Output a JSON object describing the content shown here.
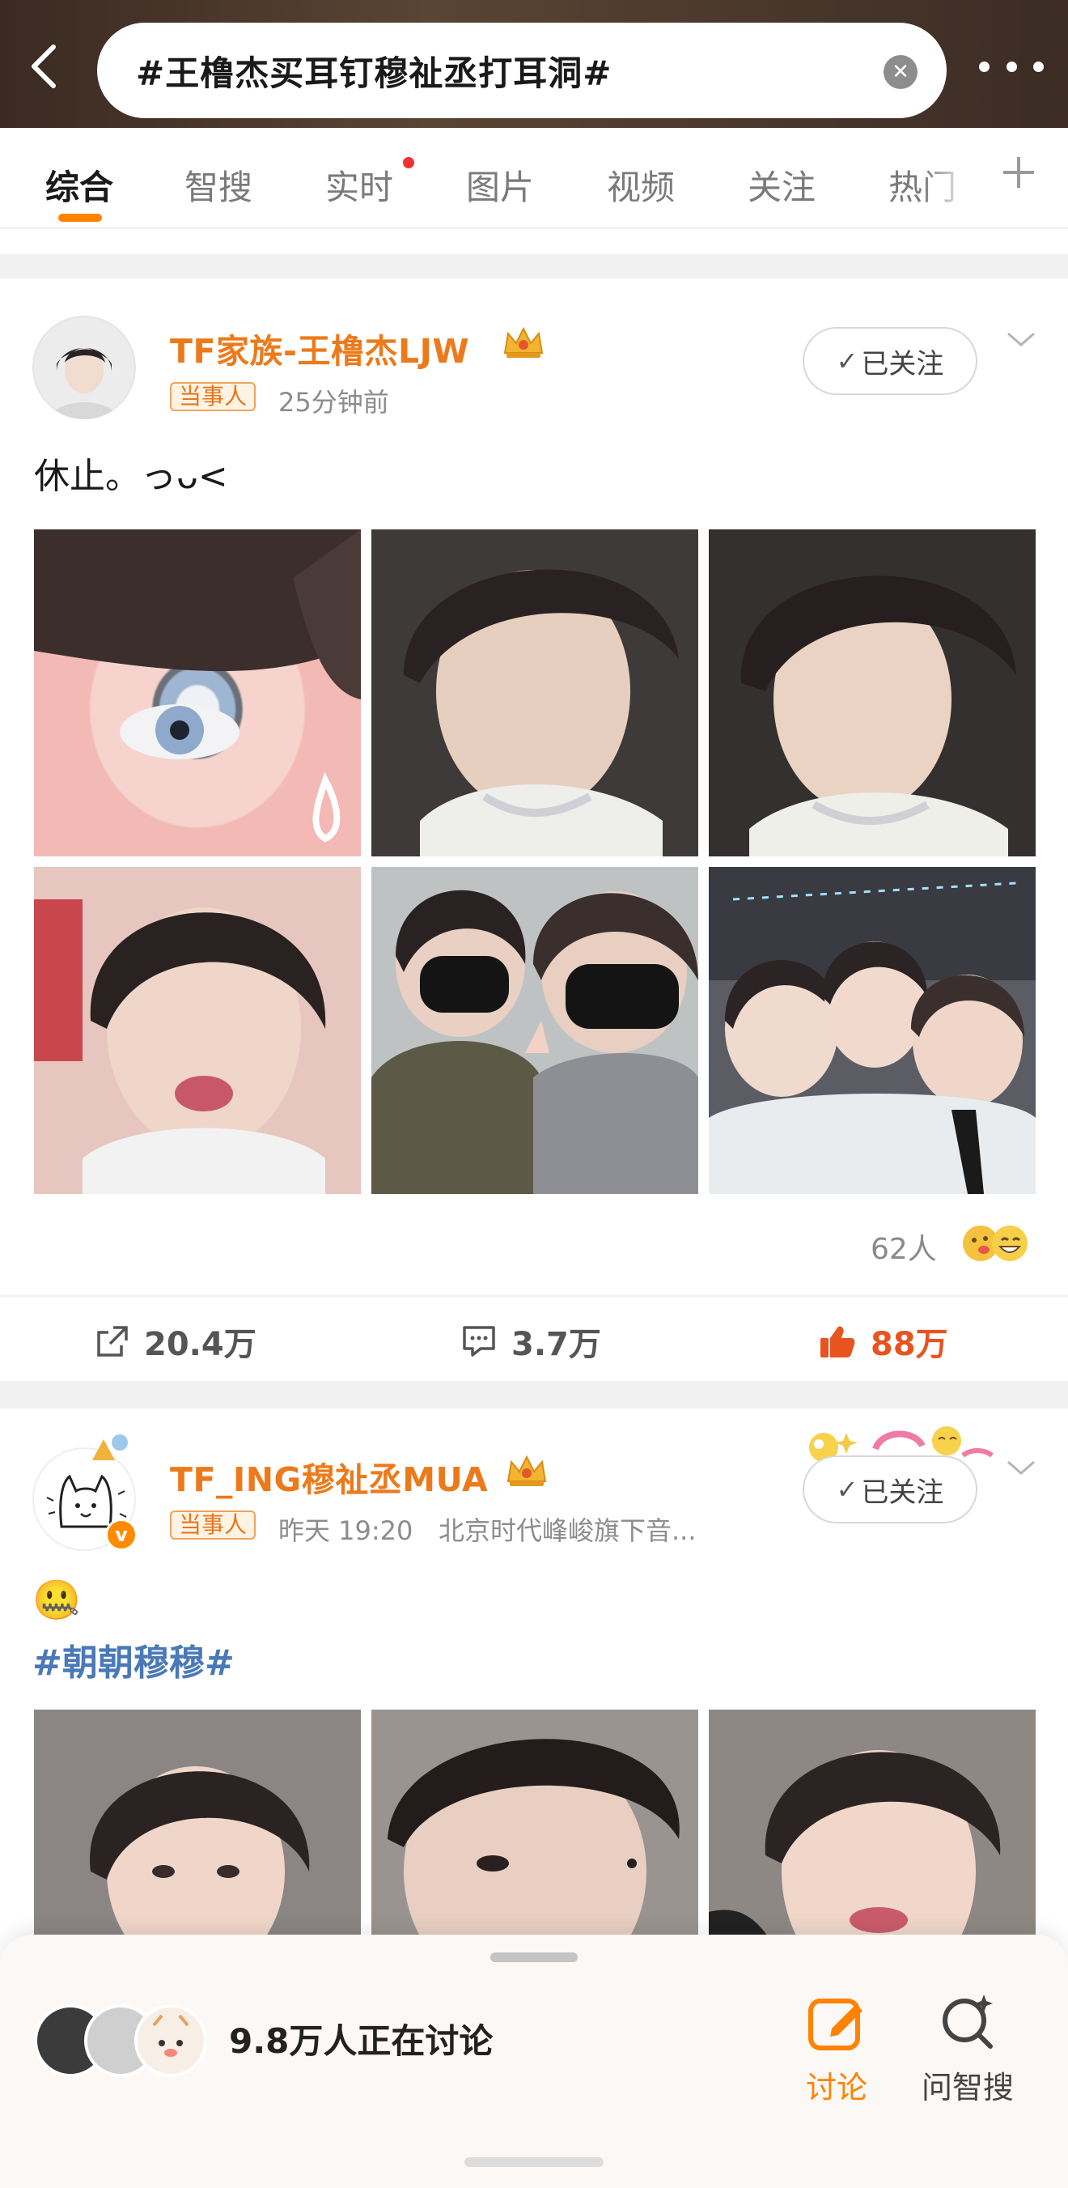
{
  "header": {
    "search_query": "#王橹杰买耳钉穆祉丞打耳洞#"
  },
  "tabs": [
    {
      "label": "综合",
      "active": true
    },
    {
      "label": "智搜"
    },
    {
      "label": "实时",
      "dot": true
    },
    {
      "label": "图片"
    },
    {
      "label": "视频"
    },
    {
      "label": "关注"
    },
    {
      "label": "热门"
    }
  ],
  "posts": [
    {
      "username": "TF家族-王橹杰LJW",
      "badge": "当事人",
      "time": "25分钟前",
      "follow_label": "已关注",
      "text": "休止。っᴗ<",
      "reactions": "62人",
      "repost": "20.4万",
      "comments": "3.7万",
      "likes": "88万"
    },
    {
      "username": "TF_ING穆祉丞MUA",
      "badge": "当事人",
      "time": "昨天 19:20",
      "source": "北京时代峰峻旗下音...",
      "follow_label": "已关注",
      "emoji": "🤐",
      "hashtag": "#朝朝穆穆#"
    }
  ],
  "bottom": {
    "discussing": "9.8万人正在讨论",
    "discuss_label": "讨论",
    "ask_label": "问智搜"
  },
  "colors": {
    "accent": "#ff8200",
    "username": "#ec7a1b",
    "like": "#e8531f",
    "hashtag": "#4a79b8"
  }
}
